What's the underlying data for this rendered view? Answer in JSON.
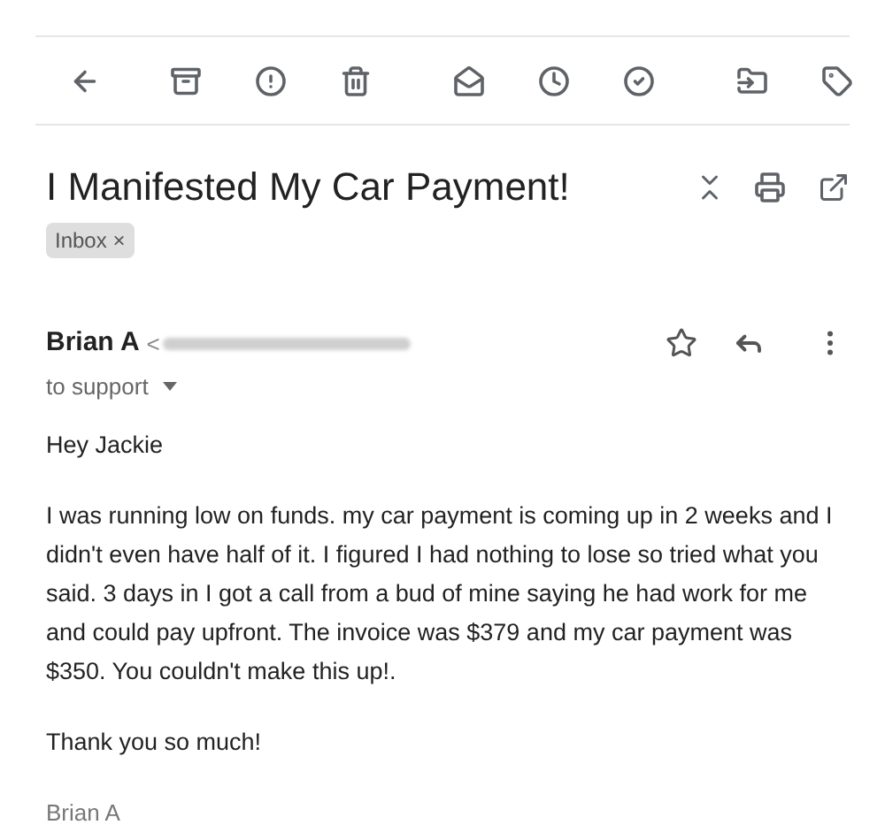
{
  "subject": "I Manifested My Car Payment!",
  "labels": [
    {
      "text": "Inbox",
      "remove": "×"
    }
  ],
  "sender": {
    "name": "Brian A",
    "address_open": "<",
    "to": "to support"
  },
  "body": [
    "Hey Jackie",
    "I was running low on funds. my car payment is coming up in 2 weeks and I didn't even have half of it. I figured I had nothing to lose so tried what you said. 3 days in I got a call from a bud of mine saying he had work for me and could pay upfront. The invoice was $379 and my car payment was $350. You couldn't make this up!.",
    "Thank you so much!"
  ],
  "signature": "Brian A"
}
